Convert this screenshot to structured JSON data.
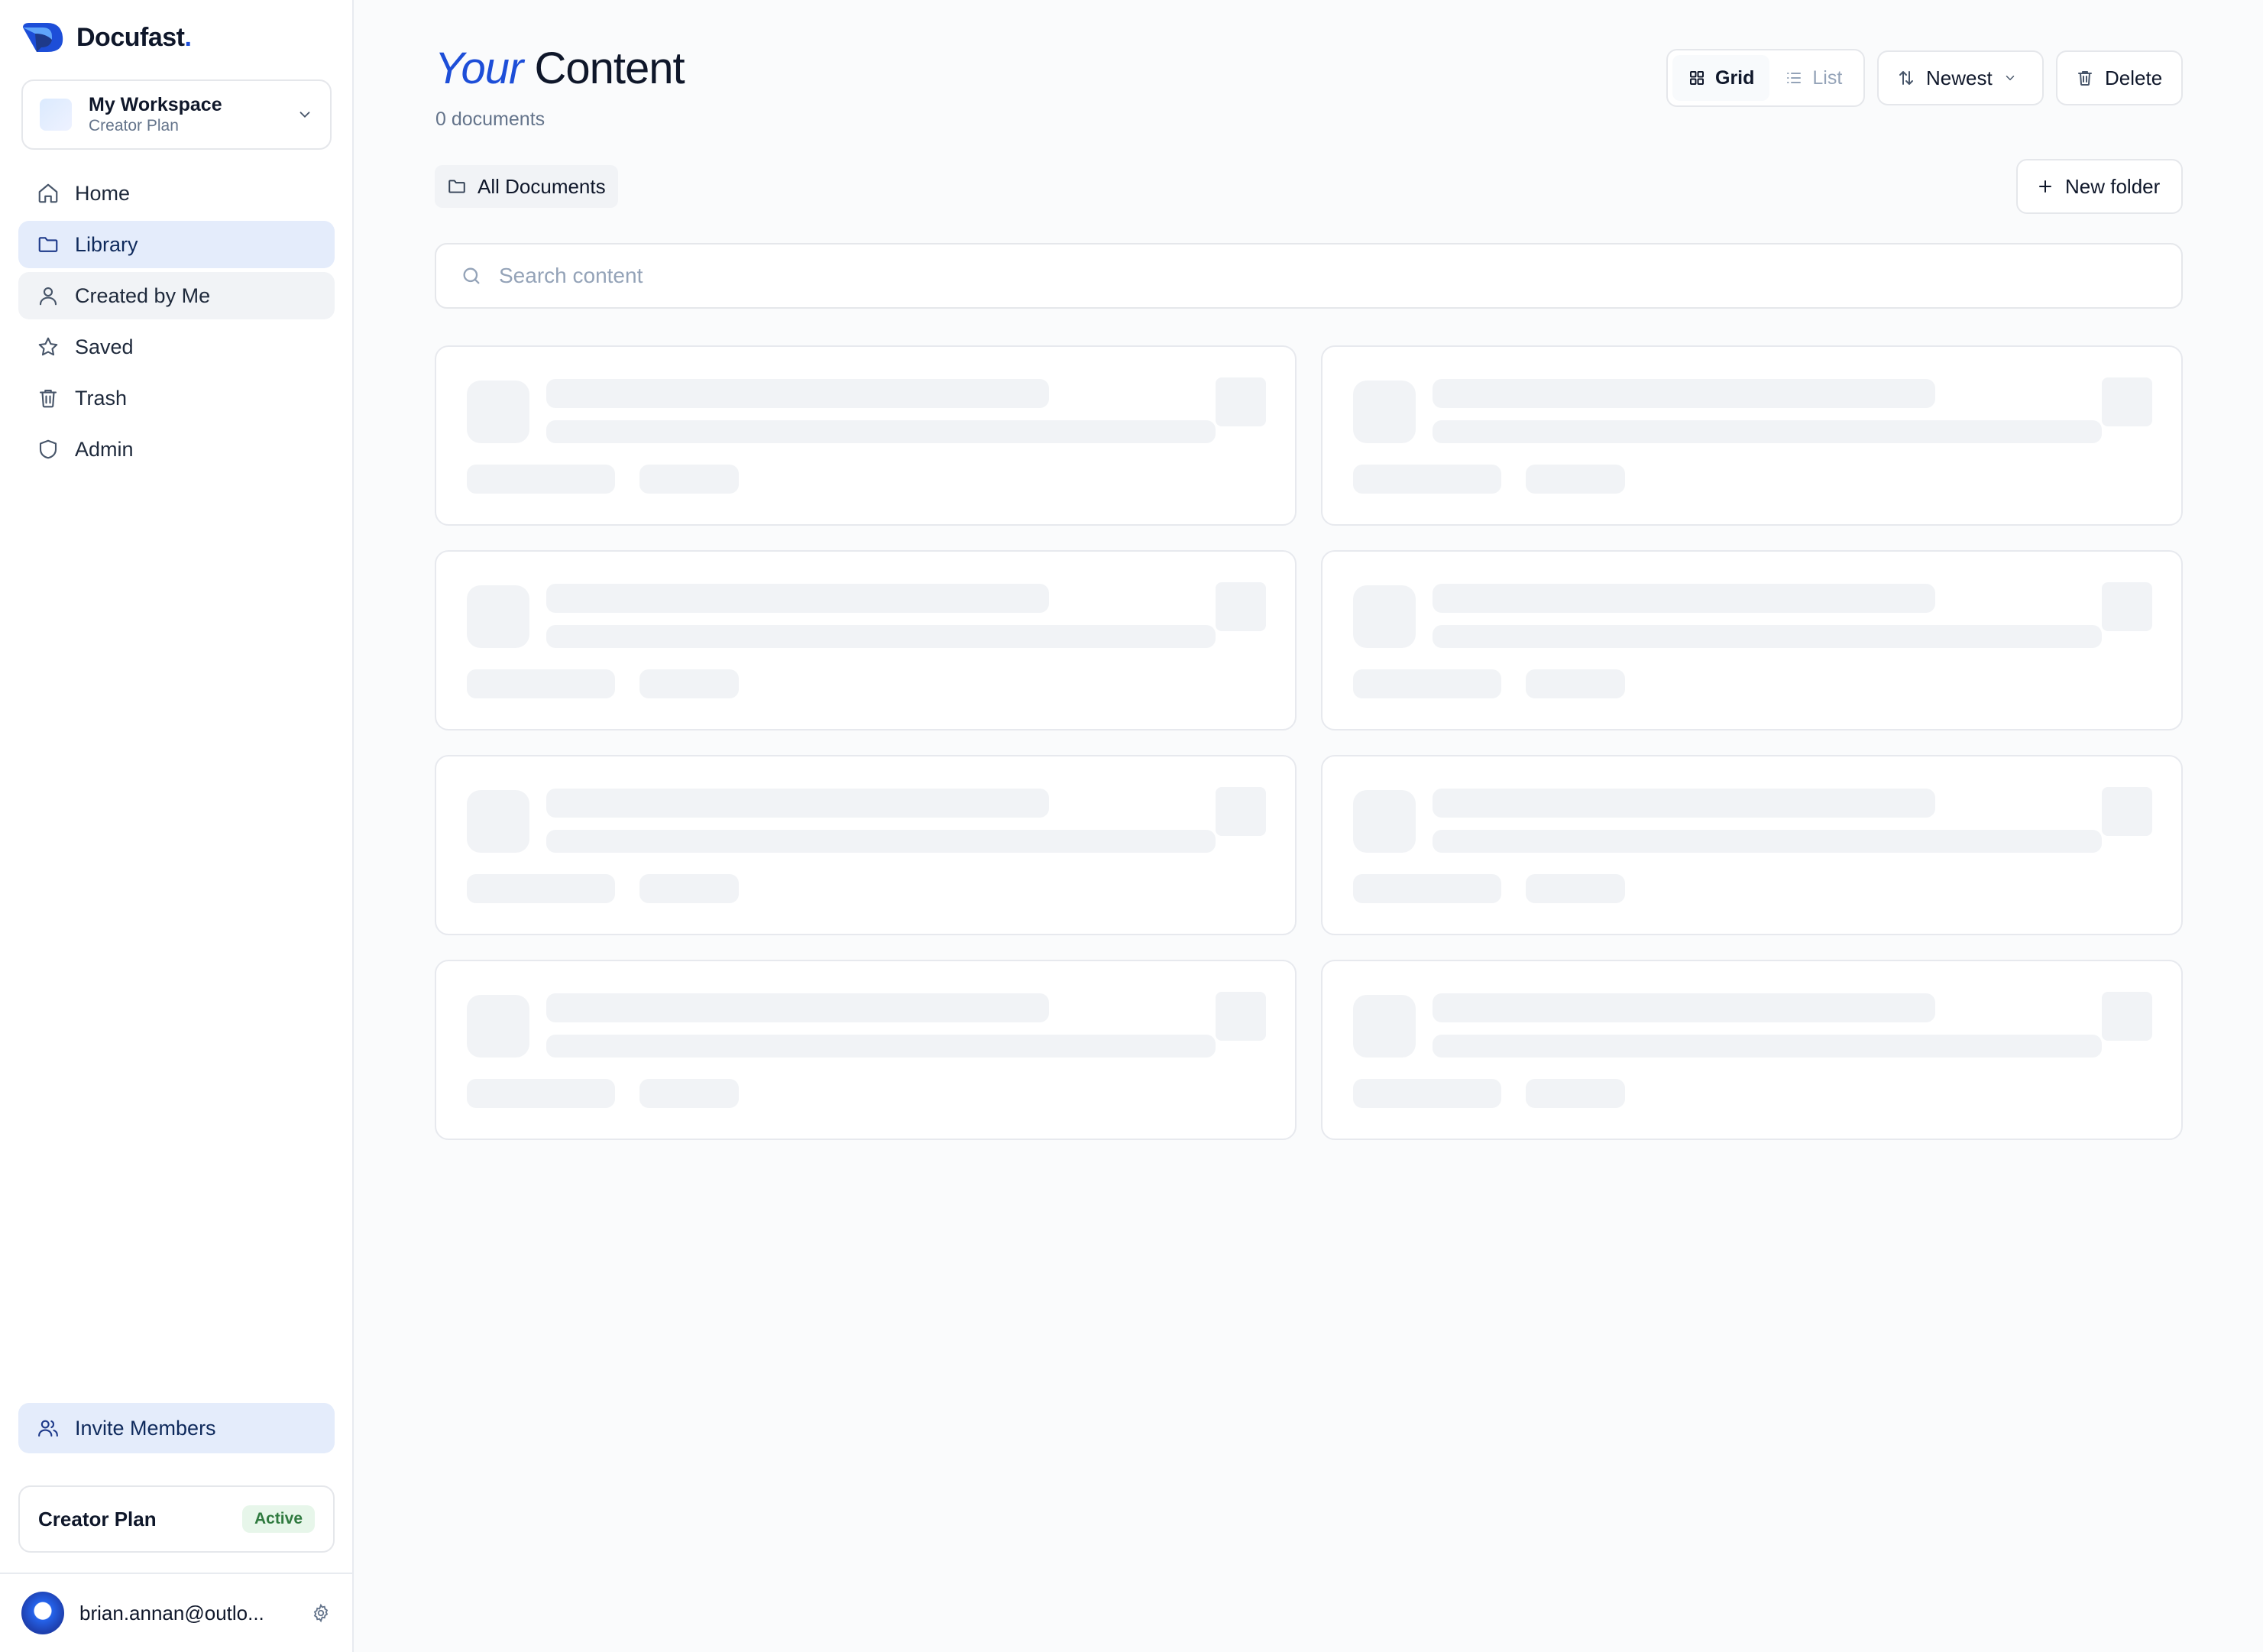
{
  "brand": {
    "name": "Docufast",
    "dot": "."
  },
  "workspace": {
    "name": "My Workspace",
    "plan": "Creator Plan"
  },
  "nav": {
    "items": [
      {
        "label": "Home",
        "icon": "home-icon"
      },
      {
        "label": "Library",
        "icon": "folder-icon",
        "active": true
      },
      {
        "label": "Created by Me",
        "icon": "user-icon"
      },
      {
        "label": "Saved",
        "icon": "star-icon"
      },
      {
        "label": "Trash",
        "icon": "trash-icon"
      },
      {
        "label": "Admin",
        "icon": "shield-icon"
      }
    ]
  },
  "invite": {
    "label": "Invite Members"
  },
  "plan": {
    "name": "Creator Plan",
    "status": "Active"
  },
  "user": {
    "email": "brian.annan@outlo..."
  },
  "main": {
    "title_accent": "Your",
    "title_rest": "Content",
    "doc_count": "0 documents",
    "view": {
      "grid_label": "Grid",
      "list_label": "List",
      "selected": "Grid"
    },
    "sort": {
      "label": "Newest"
    },
    "delete_label": "Delete",
    "folder_chip": "All Documents",
    "new_folder_label": "New folder",
    "search": {
      "placeholder": "Search content",
      "value": ""
    },
    "skeleton_card_count": 8
  },
  "colors": {
    "accent": "#1d4ed8",
    "nav_active_bg": "#e4ecfb",
    "badge_bg": "#e7f6ea",
    "badge_text": "#2f7a3f",
    "skeleton": "#f1f3f6"
  }
}
